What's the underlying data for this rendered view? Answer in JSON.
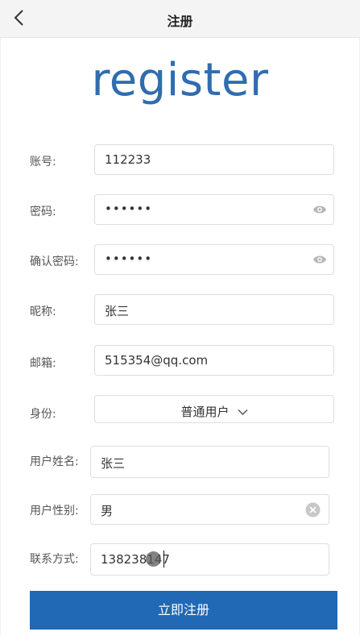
{
  "header": {
    "title": "注册"
  },
  "logo": {
    "text": "register"
  },
  "form": {
    "account": {
      "label": "账号:",
      "value": "112233"
    },
    "password": {
      "label": "密码:",
      "value": "••••••"
    },
    "confirm_password": {
      "label": "确认密码:",
      "value": "••••••"
    },
    "nickname": {
      "label": "昵称:",
      "value": "张三"
    },
    "email": {
      "label": "邮箱:",
      "value": "515354@qq.com"
    },
    "identity": {
      "label": "身份:",
      "value": "普通用户"
    },
    "real_name": {
      "label": "用户姓名:",
      "value": "张三"
    },
    "gender": {
      "label": "用户性别:",
      "value": "男"
    },
    "phone": {
      "label": "联系方式:",
      "value": "138238147"
    }
  },
  "submit": {
    "label": "立即注册"
  },
  "icons": {
    "back": "chevron-left-icon",
    "eye": "eye-icon",
    "clear": "clear-icon",
    "dropdown": "chevron-down-icon"
  },
  "colors": {
    "brand": "#2f6db0",
    "button": "#2168b5",
    "header_bg": "#f4f4f4"
  }
}
